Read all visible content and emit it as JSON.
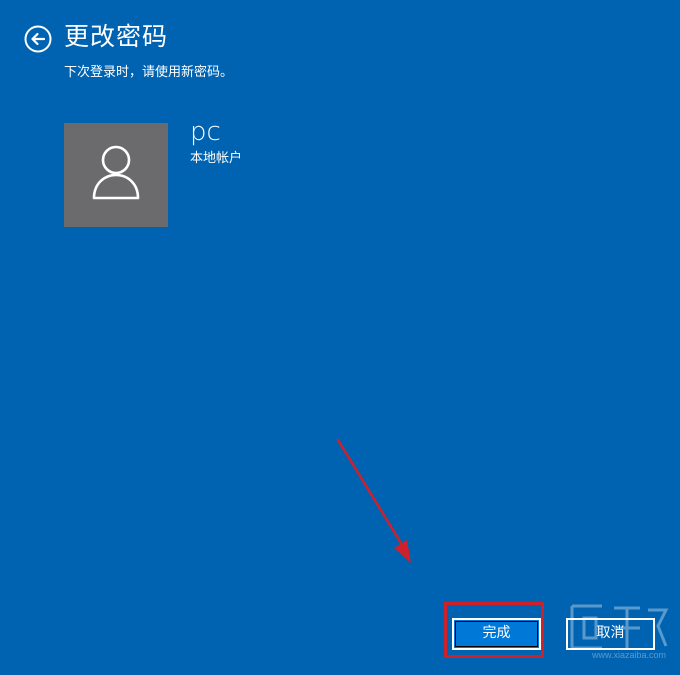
{
  "header": {
    "back_icon": "back-arrow-icon",
    "title": "更改密码",
    "subtitle": "下次登录时，请使用新密码。"
  },
  "account": {
    "avatar_icon": "user-icon",
    "name": "pc",
    "type": "本地帐户"
  },
  "actions": {
    "finish_label": "完成",
    "cancel_label": "取消"
  },
  "colors": {
    "background": "#0063b1",
    "avatar_background": "#6b6b6d",
    "primary_button": "#0078d7",
    "annotation": "#d0202a"
  },
  "watermark": {
    "text": "www.xiazaiba.com"
  }
}
